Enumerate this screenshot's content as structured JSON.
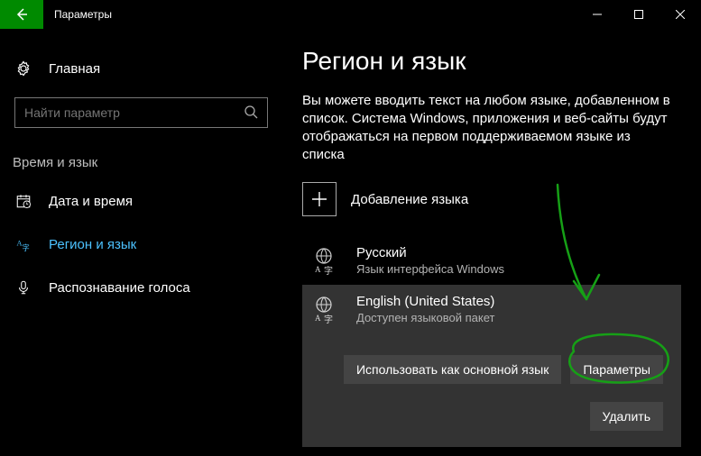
{
  "titlebar": {
    "title": "Параметры"
  },
  "sidebar": {
    "home": "Главная",
    "search_placeholder": "Найти параметр",
    "section": "Время и язык",
    "items": [
      {
        "label": "Дата и время"
      },
      {
        "label": "Регион и язык"
      },
      {
        "label": "Распознавание голоса"
      }
    ]
  },
  "main": {
    "heading": "Регион и язык",
    "description": "Вы можете вводить текст на любом языке, добавленном в список. Система Windows, приложения и веб-сайты будут отображаться на первом поддерживаемом языке из списка",
    "add_language": "Добавление языка",
    "languages": [
      {
        "name": "Русский",
        "sub": "Язык интерфейса Windows"
      },
      {
        "name": "English (United States)",
        "sub": "Доступен языковой пакет"
      }
    ],
    "buttons": {
      "set_default": "Использовать как основной язык",
      "options": "Параметры",
      "remove": "Удалить"
    }
  },
  "annotation": {
    "color": "#16a016"
  }
}
